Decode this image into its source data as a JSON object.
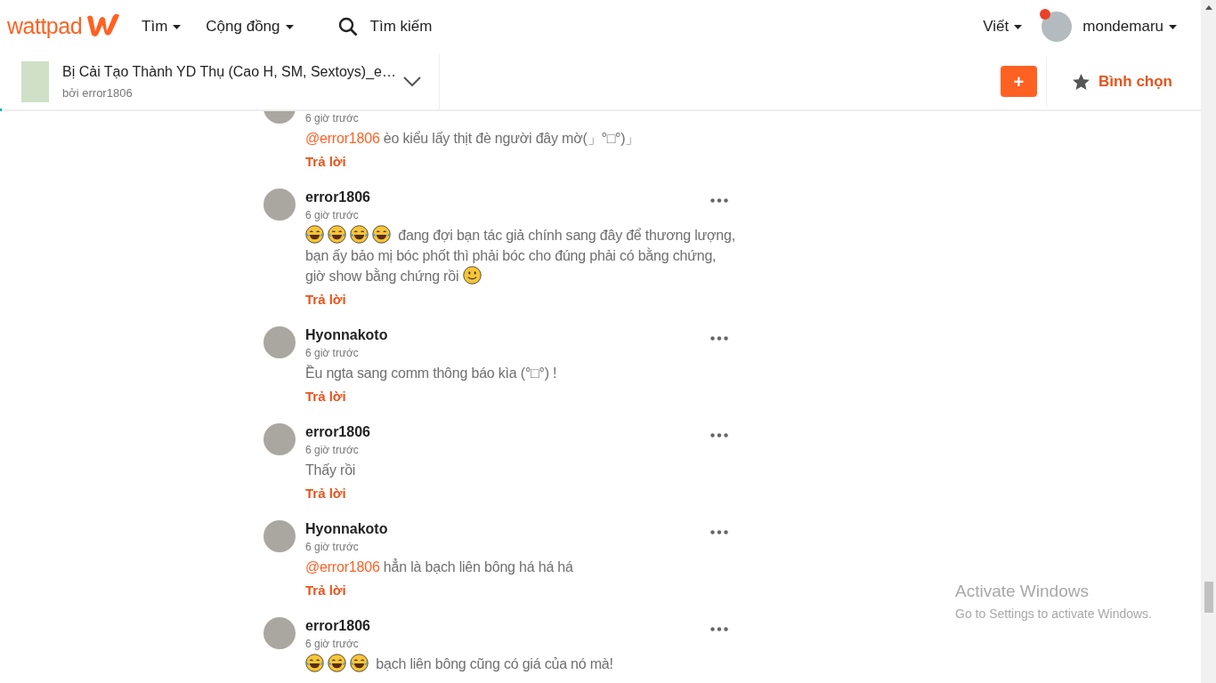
{
  "nav": {
    "logo": "wattpad",
    "menus": [
      {
        "label": "Tìm"
      },
      {
        "label": "Cộng đồng"
      }
    ],
    "search": {
      "placeholder": "Tìm kiếm"
    },
    "write": "Viết",
    "user": {
      "name": "mondemaru",
      "notification": true
    }
  },
  "story": {
    "title": "Bị Cải Tạo Thành YD Thụ (Cao H, SM, Sextoys)_e…",
    "byline": "bởi error1806",
    "add": "+",
    "vote": "Bình chọn",
    "progress": {
      "level": 0.005
    }
  },
  "comments": [
    {
      "time": "6 giờ trước",
      "body": [
        {
          "kind": "mention",
          "text": "@error1806"
        },
        {
          "kind": "text",
          "text": " èo kiểu lấy thịt đè người đây mờ(」°□°)」"
        }
      ],
      "reply": "Trả lời",
      "more": false
    },
    {
      "author": "error1806",
      "time": "6 giờ trước",
      "body": [
        {
          "kind": "laugh_emoji"
        },
        {
          "kind": "laugh_emoji"
        },
        {
          "kind": "laugh_emoji"
        },
        {
          "kind": "laugh_emoji"
        },
        {
          "kind": "text",
          "text": " đang đợi bạn tác giả chính sang đây để thương lượng, bạn ấy bảo mị bóc phốt thì phải bóc cho đúng phải có bằng chứng, giờ show bằng chứng rồi "
        },
        {
          "kind": "smile_emoji"
        }
      ],
      "reply": "Trả lời",
      "more": true
    },
    {
      "author": "Hyonnakoto",
      "time": "6 giờ trước",
      "body": [
        {
          "kind": "text",
          "text": "Ều ngta sang comm thông báo kìa (°□°) !"
        }
      ],
      "reply": "Trả lời",
      "more": true
    },
    {
      "author": "error1806",
      "time": "6 giờ trước",
      "body": [
        {
          "kind": "text",
          "text": "Thấy rồi"
        }
      ],
      "reply": "Trả lời",
      "more": true
    },
    {
      "author": "Hyonnakoto",
      "time": "6 giờ trước",
      "body": [
        {
          "kind": "mention",
          "text": "@error1806"
        },
        {
          "kind": "text",
          "text": " hẳn là bạch liên bông há há há"
        }
      ],
      "reply": "Trả lời",
      "more": true
    },
    {
      "author": "error1806",
      "time": "6 giờ trước",
      "body": [
        {
          "kind": "laugh_emoji"
        },
        {
          "kind": "laugh_emoji"
        },
        {
          "kind": "laugh_emoji"
        },
        {
          "kind": "text",
          "text": " bạch liên bông cũng có giá của nó mà!"
        }
      ],
      "more": true
    }
  ],
  "windows_activation": {
    "title": "Activate Windows",
    "subtitle": "Go to Settings to activate Windows."
  }
}
